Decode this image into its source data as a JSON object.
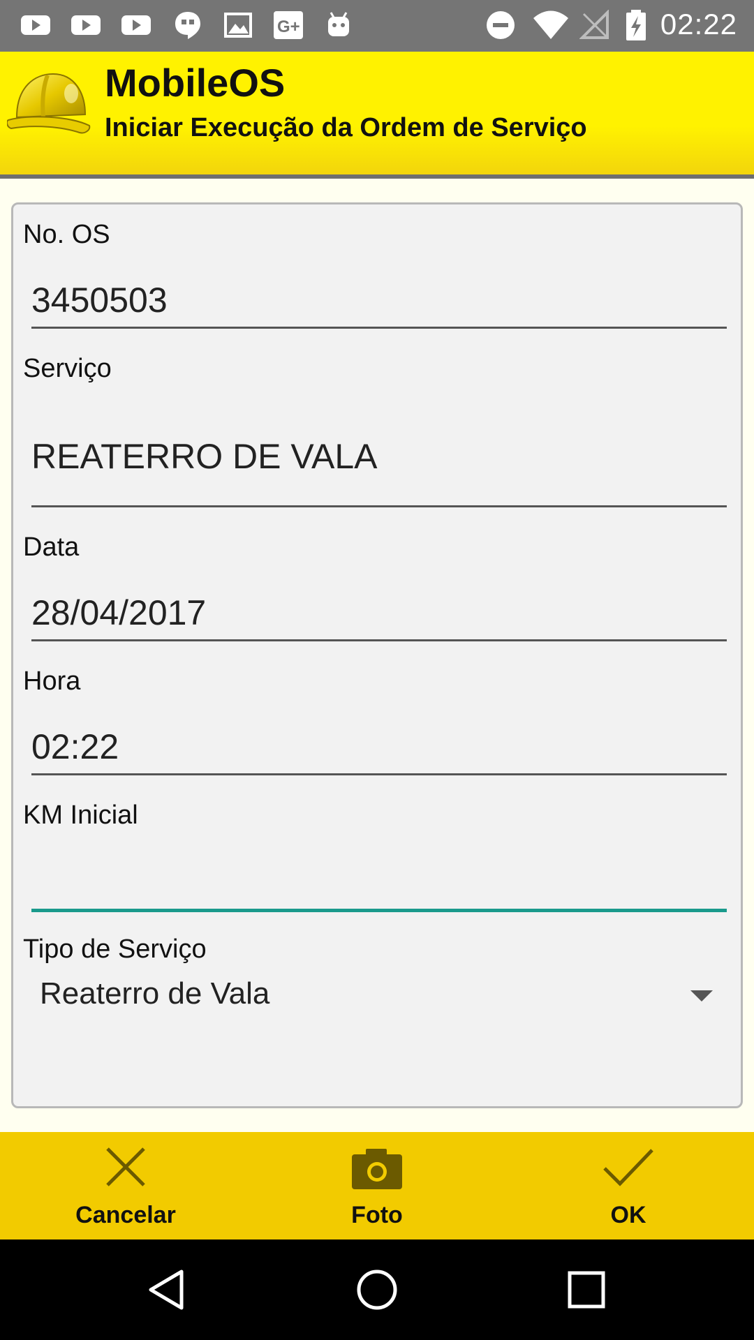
{
  "status_bar": {
    "time": "02:22",
    "left_icons": [
      "youtube-icon",
      "youtube-icon",
      "youtube-icon",
      "hangouts-icon",
      "gallery-icon",
      "google-plus-icon",
      "android-icon"
    ],
    "right_icons": [
      "do-not-disturb-icon",
      "wifi-icon",
      "no-signal-icon",
      "battery-charging-icon"
    ]
  },
  "header": {
    "title": "MobileOS",
    "subtitle": "Iniciar Execução da Ordem de Serviço",
    "logo": "helmet-icon"
  },
  "form": {
    "os_number": {
      "label": "No. OS",
      "value": "3450503"
    },
    "service": {
      "label": "Serviço",
      "value": "REATERRO DE VALA"
    },
    "date": {
      "label": "Data",
      "value": "28/04/2017"
    },
    "time": {
      "label": "Hora",
      "value": "02:22"
    },
    "km_initial": {
      "label": "KM Inicial",
      "value": ""
    },
    "service_type": {
      "label": "Tipo de Serviço",
      "selected": "Reaterro de Vala"
    }
  },
  "actions": {
    "cancel": "Cancelar",
    "photo": "Foto",
    "ok": "OK"
  },
  "colors": {
    "header_yellow": "#fff200",
    "action_bar": "#f2cb00",
    "focus_underline": "#1a9a8c",
    "status_bar": "#757575"
  }
}
